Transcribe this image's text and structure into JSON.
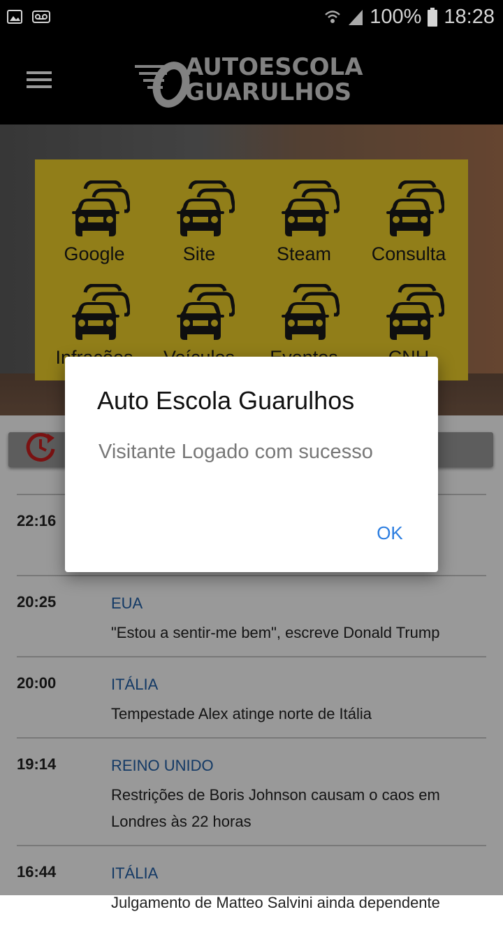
{
  "status_bar": {
    "battery": "100%",
    "time": "18:28"
  },
  "app_bar": {
    "logo_line1": "AUTOESCOLA",
    "logo_line2": "GUARULHOS"
  },
  "grid": {
    "items": [
      {
        "label": "Google"
      },
      {
        "label": "Site"
      },
      {
        "label": "Steam"
      },
      {
        "label": "Consulta"
      },
      {
        "label": "Infrações"
      },
      {
        "label": "Veículos"
      },
      {
        "label": "Eventos"
      },
      {
        "label": "CNH"
      }
    ]
  },
  "news": {
    "items": [
      {
        "time": "22:16",
        "tag": "",
        "headline": ""
      },
      {
        "time": "20:25",
        "tag": "EUA",
        "headline": "\"Estou a sentir-me bem\", escreve Donald Trump"
      },
      {
        "time": "20:00",
        "tag": "ITÁLIA",
        "headline": "Tempestade Alex atinge norte de Itália"
      },
      {
        "time": "19:14",
        "tag": "REINO UNIDO",
        "headline": "Restrições de Boris Johnson causam o caos em Londres às 22 horas"
      },
      {
        "time": "16:44",
        "tag": "ITÁLIA",
        "headline": "Julgamento de Matteo Salvini ainda dependente"
      }
    ]
  },
  "dialog": {
    "title": "Auto Escola Guarulhos",
    "message": "Visitante Logado com sucesso",
    "ok_label": "OK"
  },
  "colors": {
    "grid_bg": "#f2d32b",
    "accent": "#2b7de0",
    "tag": "#2060a8",
    "history_icon": "#cc1f1f"
  }
}
